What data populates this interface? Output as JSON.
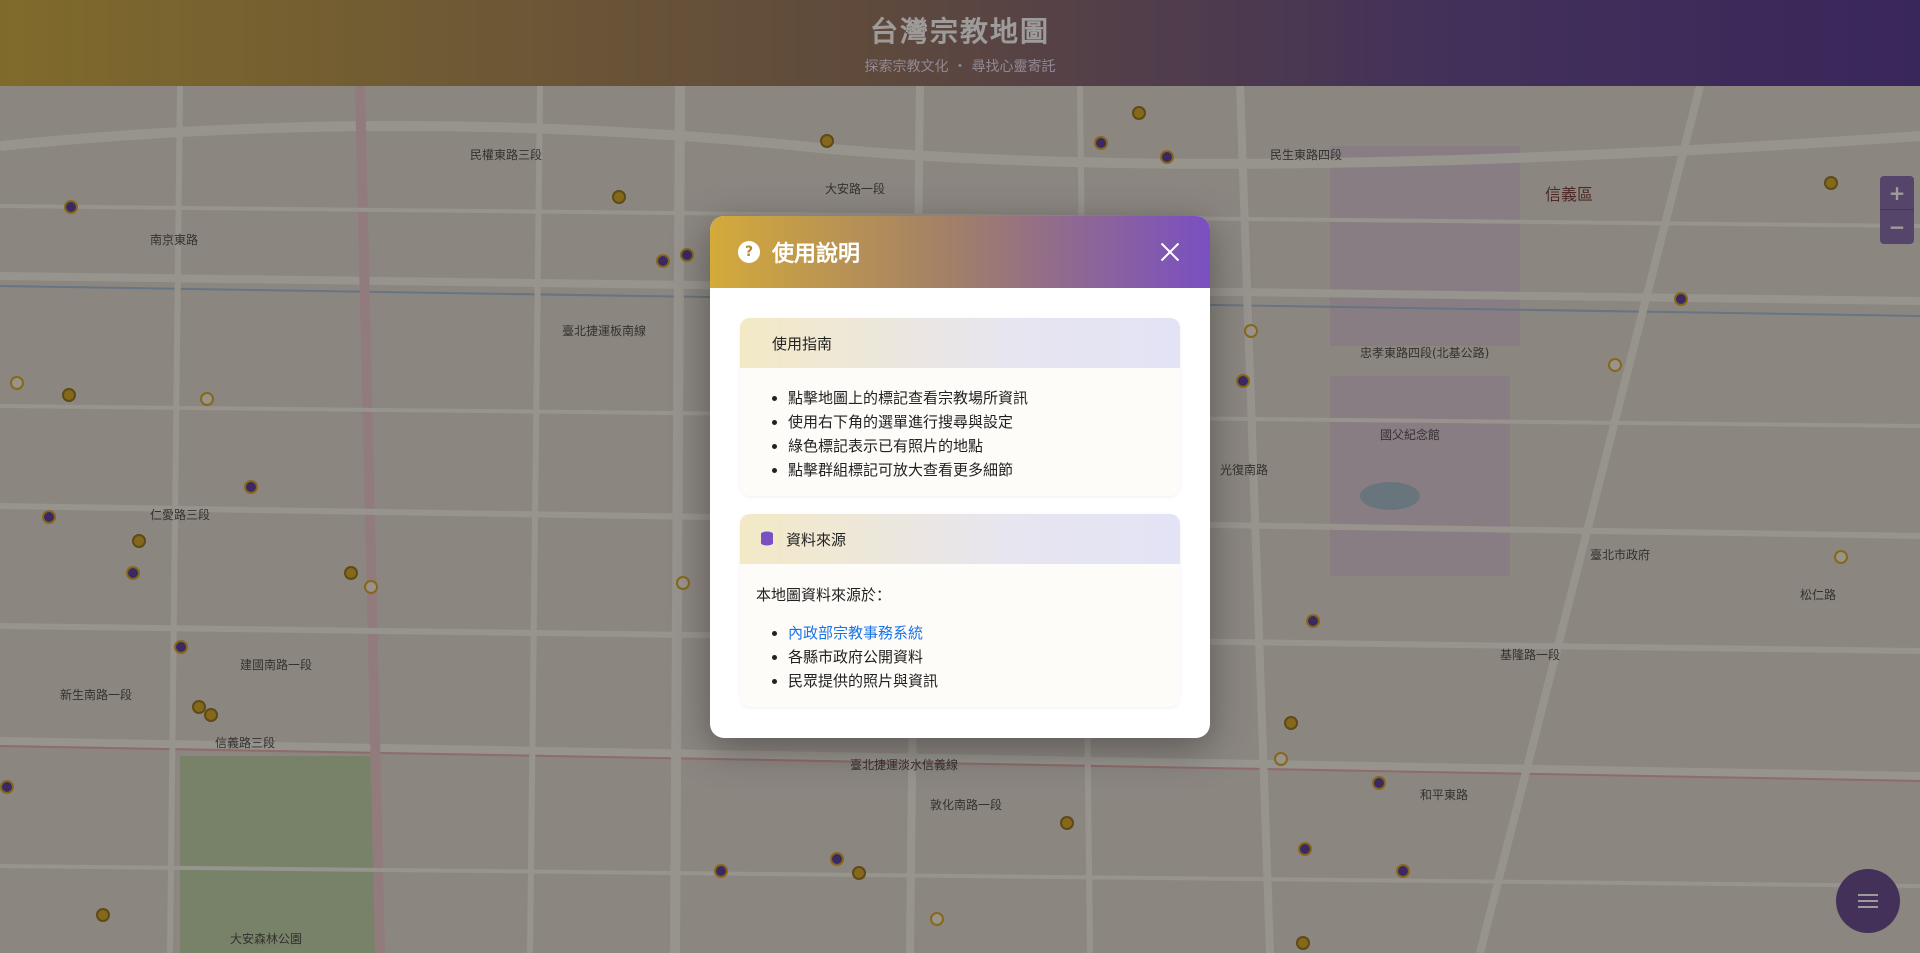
{
  "header": {
    "title": "台灣宗教地圖",
    "subtitle": "探索宗教文化 ・ 尋找心靈寄託"
  },
  "map": {
    "labels": [
      "民權東路三段",
      "民生東路四段",
      "南京東路",
      "忠孝東路四段(北基公路)",
      "臺北捷運板南線",
      "臺北捷運淡水信義線",
      "信義區",
      "基隆路一段",
      "光復南路",
      "仁愛路三段",
      "敦化南路一段",
      "大安路一段",
      "新生南路一段",
      "建國南路一段",
      "信義路三段",
      "國父紀念館",
      "臺北市政府",
      "大安森林公園",
      "松仁路",
      "和平東路"
    ],
    "zoom_in": "+",
    "zoom_out": "−"
  },
  "modal": {
    "title": "使用說明",
    "help_icon": "?",
    "guide": {
      "heading": "使用指南",
      "items": [
        "點擊地圖上的標記查看宗教場所資訊",
        "使用右下角的選單進行搜尋與設定",
        "綠色標記表示已有照片的地點",
        "點擊群組標記可放大查看更多細節"
      ]
    },
    "source": {
      "heading": "資料來源",
      "intro": "本地圖資料來源於：",
      "items": [
        "內政部宗教事務系統",
        "各縣市政府公開資料",
        "民眾提供的照片與資訊"
      ]
    }
  },
  "colors": {
    "accent_gold": "#d4a017",
    "accent_purple": "#4b2f9a",
    "link": "#1a73e8"
  }
}
